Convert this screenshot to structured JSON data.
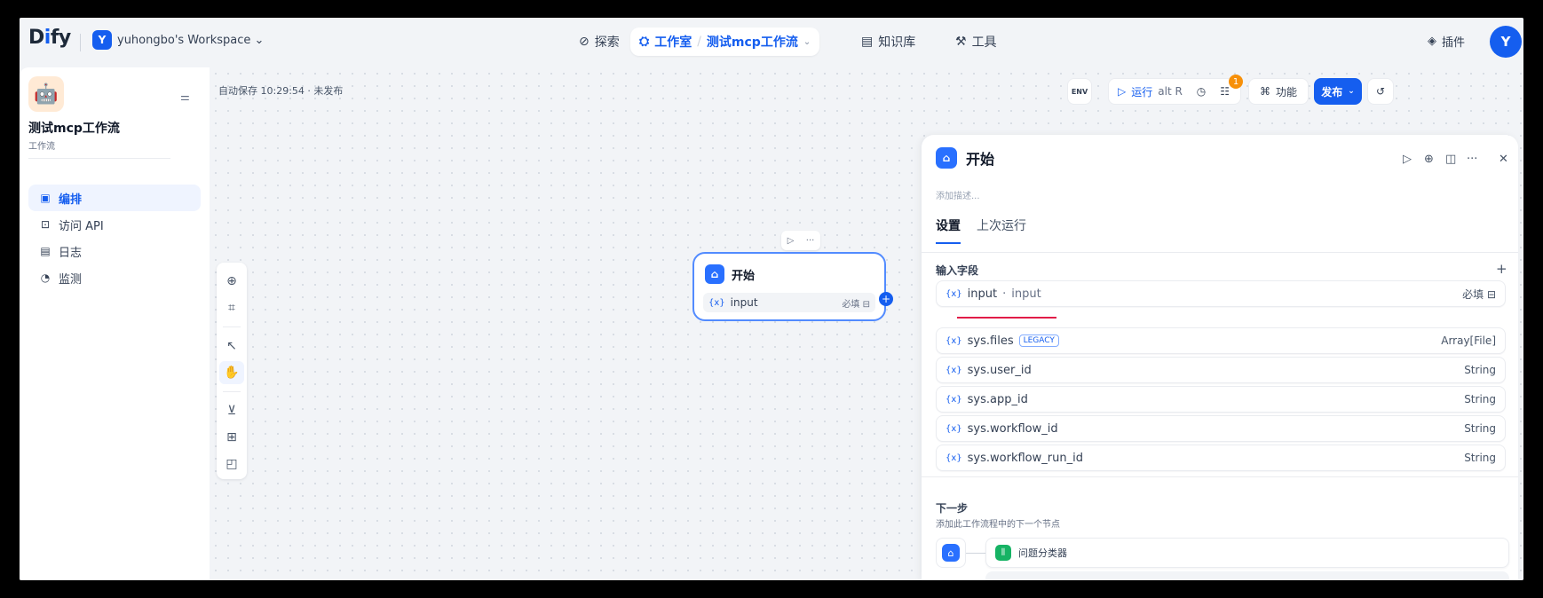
{
  "brand": {
    "logo": "Dify"
  },
  "workspace": {
    "badge": "Y",
    "name": "yuhongbo's Workspace ⌄"
  },
  "nav": {
    "explore": "探索",
    "studio": "工作室",
    "app_name": "测试mcp工作流",
    "knowledge": "知识库",
    "tools": "工具"
  },
  "header_right": {
    "plugins": "插件",
    "avatar": "Y"
  },
  "sidebar": {
    "app_name": "测试mcp工作流",
    "app_type": "工作流",
    "items": [
      {
        "label": "编排",
        "icon": "layout-icon"
      },
      {
        "label": "访问 API",
        "icon": "terminal-icon"
      },
      {
        "label": "日志",
        "icon": "log-icon"
      },
      {
        "label": "监测",
        "icon": "monitor-icon"
      }
    ]
  },
  "canvas": {
    "autosave": "自动保存 10:29:54 · 未发布",
    "env_label": "ENV",
    "run_label": "运行",
    "run_shortcut": "alt R",
    "checklist_count": "1",
    "features_label": "功能",
    "publish_label": "发布"
  },
  "start_node": {
    "title": "开始",
    "var_name": "input",
    "required": "必填"
  },
  "panel": {
    "title": "开始",
    "description_placeholder": "添加描述...",
    "tabs": [
      "设置",
      "上次运行"
    ],
    "input_section": "输入字段",
    "input_field": {
      "name": "input",
      "label": "input",
      "required": "必填"
    },
    "sys_fields": [
      {
        "name": "sys.files",
        "tag": "LEGACY",
        "type": "Array[File]"
      },
      {
        "name": "sys.user_id",
        "type": "String"
      },
      {
        "name": "sys.app_id",
        "type": "String"
      },
      {
        "name": "sys.workflow_id",
        "type": "String"
      },
      {
        "name": "sys.workflow_run_id",
        "type": "String"
      }
    ],
    "next_title": "下一步",
    "next_subtitle": "添加此工作流程中的下一个节点",
    "next_node": "问题分类器"
  },
  "colors": {
    "accent": "#155eef",
    "badge": "#f79009",
    "highlight": "#e11d48",
    "classifier": "#16b364"
  }
}
